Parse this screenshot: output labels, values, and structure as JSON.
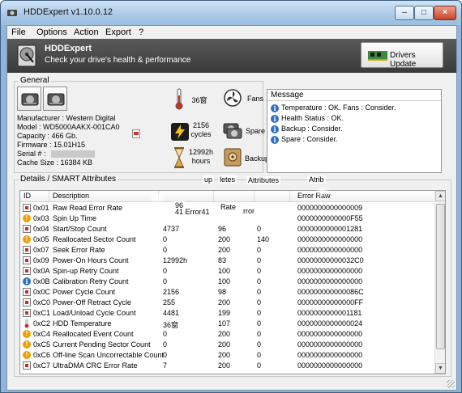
{
  "window": {
    "title": "HDDExpert v1.10.0.12",
    "min_label": "–",
    "max_label": "□",
    "close_label": "×"
  },
  "menu": [
    "File",
    "Options",
    "Action",
    "Export",
    "?"
  ],
  "banner": {
    "title": "HDDExpert",
    "subtitle": "Check your drive's health & performance",
    "drivers_button": "Drivers Update"
  },
  "general": {
    "title": "General",
    "manufacturer": "Manufacturer : Western Digital",
    "model": "Model : WD5000AAKX-001CA0",
    "capacity": "Capacity : 466 Gb.",
    "firmware": "Firmware : 15.01H15",
    "serial": "Serial # :",
    "cache": "Cache Size : 16384 KB"
  },
  "metrics": {
    "temperature": "36窗",
    "fans": "Fans",
    "cycles_value": "2156",
    "cycles_label": "cycles",
    "spare": "Spare",
    "hours_value": "12992h",
    "hours_label": "hours",
    "backup": "Backup"
  },
  "messages": {
    "header": "Message",
    "items": [
      "Temperature : OK. Fans : Consider.",
      "Health Status : OK.",
      "Backup : Consider.",
      "Spare : Consider."
    ]
  },
  "details": {
    "title": "Details / SMART Attributes",
    "columns": [
      "ID",
      "Description",
      "",
      "",
      "",
      "Error Raw"
    ],
    "rows": [
      {
        "status": "check",
        "id": "0x01",
        "desc": "Raw Read Error Rate",
        "cur": "",
        "worst": "",
        "thresh": "",
        "raw": "0000000000000009"
      },
      {
        "status": "warn",
        "id": "0x03",
        "desc": "Spin Up Time",
        "cur": "",
        "worst": "",
        "thresh": "",
        "raw": "0000000000000F55"
      },
      {
        "status": "check",
        "id": "0x04",
        "desc": "Start/Stop Count",
        "cur": "4737",
        "worst": "96",
        "thresh": "0",
        "raw": "0000000000001281"
      },
      {
        "status": "warn",
        "id": "0x05",
        "desc": "Reallocated Sector Count",
        "cur": "0",
        "worst": "200",
        "thresh": "140",
        "raw": "0000000000000000"
      },
      {
        "status": "check",
        "id": "0x07",
        "desc": "Seek Error Rate",
        "cur": "0",
        "worst": "200",
        "thresh": "0",
        "raw": "0000000000000000"
      },
      {
        "status": "check",
        "id": "0x09",
        "desc": "Power-On Hours Count",
        "cur": "12992h",
        "worst": "83",
        "thresh": "0",
        "raw": "00000000000032C0"
      },
      {
        "status": "check",
        "id": "0x0A",
        "desc": "Spin-up Retry Count",
        "cur": "0",
        "worst": "100",
        "thresh": "0",
        "raw": "0000000000000000"
      },
      {
        "status": "info",
        "id": "0x0B",
        "desc": "Calibration Retry Count",
        "cur": "0",
        "worst": "100",
        "thresh": "0",
        "raw": "0000000000000000"
      },
      {
        "status": "check",
        "id": "0x0C",
        "desc": "Power Cycle Count",
        "cur": "2156",
        "worst": "98",
        "thresh": "0",
        "raw": "000000000000086C"
      },
      {
        "status": "check",
        "id": "0xC0",
        "desc": "Power-Off Retract Cycle",
        "cur": "255",
        "worst": "200",
        "thresh": "0",
        "raw": "00000000000000FF"
      },
      {
        "status": "check",
        "id": "0xC1",
        "desc": "Load/Unload Cycle Count",
        "cur": "4481",
        "worst": "199",
        "thresh": "0",
        "raw": "0000000000001181"
      },
      {
        "status": "temp",
        "id": "0xC2",
        "desc": "HDD Temperature",
        "cur": "36窗",
        "worst": "107",
        "thresh": "0",
        "raw": "0000000000000024"
      },
      {
        "status": "warn",
        "id": "0xC4",
        "desc": "Reallocated Event Count",
        "cur": "0",
        "worst": "200",
        "thresh": "0",
        "raw": "0000000000000000"
      },
      {
        "status": "warn",
        "id": "0xC5",
        "desc": "Current Pending Sector Count",
        "cur": "0",
        "worst": "200",
        "thresh": "0",
        "raw": "0000000000000000"
      },
      {
        "status": "warn",
        "id": "0xC6",
        "desc": "Off-line Scan Uncorrectable Count",
        "cur": "0",
        "worst": "200",
        "thresh": "0",
        "raw": "0000000000000000"
      },
      {
        "status": "check",
        "id": "0xC7",
        "desc": "UltraDMA CRC Error Rate",
        "cur": "7",
        "worst": "200",
        "thresh": "0",
        "raw": "0000000000000000"
      }
    ]
  },
  "overlay_fragments": {
    "top_a": "up",
    "top_b": "letes",
    "top_c": "Attributes",
    "top_d": "Atrib",
    "head_a": "96",
    "head_b": "Rate",
    "head_c": "rror",
    "head_d": "41 Error41"
  }
}
